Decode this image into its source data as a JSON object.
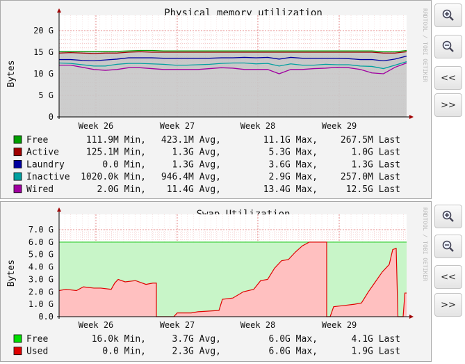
{
  "charts": [
    {
      "title": "Physical memory utilization",
      "ylabel": "Bytes",
      "watermark": "RRDTOOL / TOBI OETIKER",
      "yticks": [
        "20 G",
        "15 G",
        "10 G",
        "5 G",
        "0"
      ],
      "xticks": [
        "Week 26",
        "Week 27",
        "Week 28",
        "Week 29"
      ],
      "legend": [
        {
          "color": "#00a000",
          "name": "Free",
          "min": "111.9M Min,",
          "avg": "423.1M Avg,",
          "max": "11.1G Max,",
          "last": "267.5M Last"
        },
        {
          "color": "#a00000",
          "name": "Active",
          "min": "125.1M Min,",
          "avg": "1.3G Avg,",
          "max": "5.3G Max,",
          "last": "1.0G Last"
        },
        {
          "color": "#0000a0",
          "name": "Laundry",
          "min": "0.0  Min,",
          "avg": "1.3G Avg,",
          "max": "3.6G Max,",
          "last": "1.3G Last"
        },
        {
          "color": "#00a0a0",
          "name": "Inactive",
          "min": "1020.0k Min,",
          "avg": "946.4M Avg,",
          "max": "2.9G Max,",
          "last": "257.0M Last"
        },
        {
          "color": "#a000a0",
          "name": "Wired",
          "min": "2.0G Min,",
          "avg": "11.4G Avg,",
          "max": "13.4G Max,",
          "last": "12.5G Last"
        }
      ]
    },
    {
      "title": "Swap Utilization",
      "ylabel": "Bytes",
      "watermark": "RRDTOOL / TOBI OETIKER",
      "yticks": [
        "7.0 G",
        "6.0 G",
        "5.0 G",
        "4.0 G",
        "3.0 G",
        "2.0 G",
        "1.0 G",
        "0.0"
      ],
      "xticks": [
        "Week 26",
        "Week 27",
        "Week 28",
        "Week 29"
      ],
      "legend": [
        {
          "color": "#00e000",
          "name": "Free",
          "min": "16.0k Min,",
          "avg": "3.7G Avg,",
          "max": "6.0G Max,",
          "last": "4.1G Last"
        },
        {
          "color": "#e00000",
          "name": "Used",
          "min": "0.0  Min,",
          "avg": "2.3G Avg,",
          "max": "6.0G Max,",
          "last": "1.9G Last"
        }
      ]
    }
  ],
  "buttons": [
    {
      "label": "",
      "icon": "zoom-in-icon"
    },
    {
      "label": "",
      "icon": "zoom-out-icon"
    },
    {
      "label": "<<"
    },
    {
      "label": ">>"
    }
  ],
  "chart_data": [
    {
      "type": "area",
      "title": "Physical memory utilization",
      "ylabel": "Bytes",
      "ylim": [
        0,
        20
      ],
      "yunit": "G",
      "x_categories": [
        "Week 26",
        "Week 27",
        "Week 28",
        "Week 29"
      ],
      "stacked": true,
      "series": [
        {
          "name": "Wired",
          "color": "#a000a0",
          "values_G": [
            12.0,
            12.0,
            11.5,
            11.0,
            10.8,
            11.0,
            11.4,
            11.4,
            11.2,
            11.0,
            11.0,
            11.0,
            11.0,
            11.2,
            11.4,
            11.3,
            11.0,
            11.0,
            11.0,
            10.0,
            11.0,
            11.0,
            11.2,
            11.3,
            11.5,
            11.4,
            11.0,
            10.2,
            10.0,
            11.5,
            12.5
          ]
        },
        {
          "name": "Inactive",
          "color": "#00a0a0",
          "values_G": [
            0.5,
            0.4,
            0.6,
            0.8,
            1.0,
            1.2,
            1.0,
            1.0,
            1.1,
            1.2,
            1.0,
            1.0,
            1.1,
            1.0,
            1.0,
            1.2,
            1.5,
            1.3,
            1.4,
            1.8,
            1.3,
            1.0,
            0.8,
            0.9,
            0.6,
            0.7,
            0.8,
            1.5,
            1.2,
            0.5,
            0.3
          ]
        },
        {
          "name": "Laundry",
          "color": "#0000a0",
          "values_G": [
            0.8,
            0.9,
            1.0,
            1.2,
            1.4,
            1.2,
            1.3,
            1.3,
            1.4,
            1.4,
            1.6,
            1.6,
            1.5,
            1.4,
            1.3,
            1.2,
            1.3,
            1.4,
            1.4,
            1.6,
            1.5,
            1.6,
            1.6,
            1.4,
            1.5,
            1.4,
            1.5,
            1.6,
            1.8,
            1.4,
            1.3
          ]
        },
        {
          "name": "Active",
          "color": "#a00000",
          "values_G": [
            1.5,
            1.6,
            1.7,
            1.7,
            1.6,
            1.4,
            1.3,
            1.4,
            1.3,
            1.4,
            1.4,
            1.4,
            1.4,
            1.4,
            1.3,
            1.3,
            1.2,
            1.3,
            1.2,
            1.6,
            1.2,
            1.4,
            1.4,
            1.4,
            1.4,
            1.5,
            1.7,
            1.7,
            1.8,
            1.4,
            1.0
          ]
        },
        {
          "name": "Free",
          "color": "#00a000",
          "values_G": [
            0.4,
            0.3,
            0.4,
            0.5,
            0.4,
            0.4,
            0.3,
            0.3,
            0.4,
            0.3,
            0.3,
            0.3,
            0.3,
            0.3,
            0.3,
            0.3,
            0.3,
            0.3,
            0.3,
            0.3,
            0.3,
            0.3,
            0.3,
            0.3,
            0.3,
            0.3,
            0.3,
            0.3,
            0.3,
            0.3,
            0.3
          ]
        }
      ]
    },
    {
      "type": "area",
      "title": "Swap Utilization",
      "ylabel": "Bytes",
      "ylim": [
        0,
        7
      ],
      "yunit": "G",
      "x_categories": [
        "Week 26",
        "Week 27",
        "Week 28",
        "Week 29"
      ],
      "stacked": true,
      "x_range": [
        0,
        1
      ],
      "series": [
        {
          "name": "Used",
          "color": "#e00000",
          "points": [
            [
              0.0,
              2.1
            ],
            [
              0.02,
              2.2
            ],
            [
              0.05,
              2.1
            ],
            [
              0.07,
              2.4
            ],
            [
              0.1,
              2.3
            ],
            [
              0.12,
              2.3
            ],
            [
              0.15,
              2.2
            ],
            [
              0.16,
              2.7
            ],
            [
              0.17,
              3.0
            ],
            [
              0.19,
              2.8
            ],
            [
              0.22,
              2.9
            ],
            [
              0.25,
              2.6
            ],
            [
              0.27,
              2.7
            ],
            [
              0.28,
              2.7
            ],
            [
              0.28,
              0.0
            ],
            [
              0.33,
              0.0
            ],
            [
              0.34,
              0.3
            ],
            [
              0.38,
              0.3
            ],
            [
              0.4,
              0.4
            ],
            [
              0.46,
              0.5
            ],
            [
              0.47,
              1.4
            ],
            [
              0.5,
              1.5
            ],
            [
              0.53,
              2.0
            ],
            [
              0.56,
              2.2
            ],
            [
              0.58,
              2.9
            ],
            [
              0.6,
              3.0
            ],
            [
              0.62,
              3.9
            ],
            [
              0.64,
              4.5
            ],
            [
              0.66,
              4.6
            ],
            [
              0.68,
              5.2
            ],
            [
              0.7,
              5.7
            ],
            [
              0.72,
              6.0
            ],
            [
              0.74,
              6.0
            ],
            [
              0.77,
              6.0
            ],
            [
              0.77,
              0.0
            ],
            [
              0.78,
              0.0
            ],
            [
              0.79,
              0.8
            ],
            [
              0.82,
              0.9
            ],
            [
              0.85,
              1.0
            ],
            [
              0.87,
              1.1
            ],
            [
              0.89,
              2.0
            ],
            [
              0.91,
              2.8
            ],
            [
              0.93,
              3.6
            ],
            [
              0.95,
              4.2
            ],
            [
              0.96,
              5.4
            ],
            [
              0.97,
              5.5
            ],
            [
              0.975,
              0.0
            ],
            [
              0.99,
              0.0
            ],
            [
              0.995,
              1.9
            ],
            [
              1.0,
              1.9
            ]
          ]
        },
        {
          "name": "Free",
          "color": "#00e000",
          "total_G": 6.0
        }
      ]
    }
  ]
}
